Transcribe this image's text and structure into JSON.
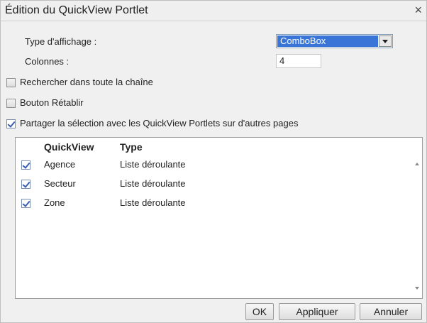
{
  "dialog": {
    "title": "Édition du QuickView Portlet",
    "close_glyph": "×"
  },
  "form": {
    "type_label": "Type d'affichage :",
    "type_value": "ComboBox",
    "columns_label": "Colonnes :",
    "columns_value": "4",
    "options": [
      {
        "label": "Rechercher dans toute la chaîne",
        "checked": false
      },
      {
        "label": "Bouton Rétablir",
        "checked": false
      },
      {
        "label": "Partager la sélection avec les QuickView Portlets sur d'autres pages",
        "checked": true
      }
    ]
  },
  "table": {
    "headers": [
      "QuickView",
      "Type"
    ],
    "rows": [
      {
        "checked": true,
        "name": "Agence",
        "type": "Liste déroulante"
      },
      {
        "checked": true,
        "name": "Secteur",
        "type": "Liste déroulante"
      },
      {
        "checked": true,
        "name": "Zone",
        "type": "Liste déroulante"
      }
    ]
  },
  "buttons": {
    "ok": "OK",
    "apply": "Appliquer",
    "cancel": "Annuler"
  },
  "colors": {
    "selection": "#3875d7",
    "checkmark": "#3a5db0"
  }
}
